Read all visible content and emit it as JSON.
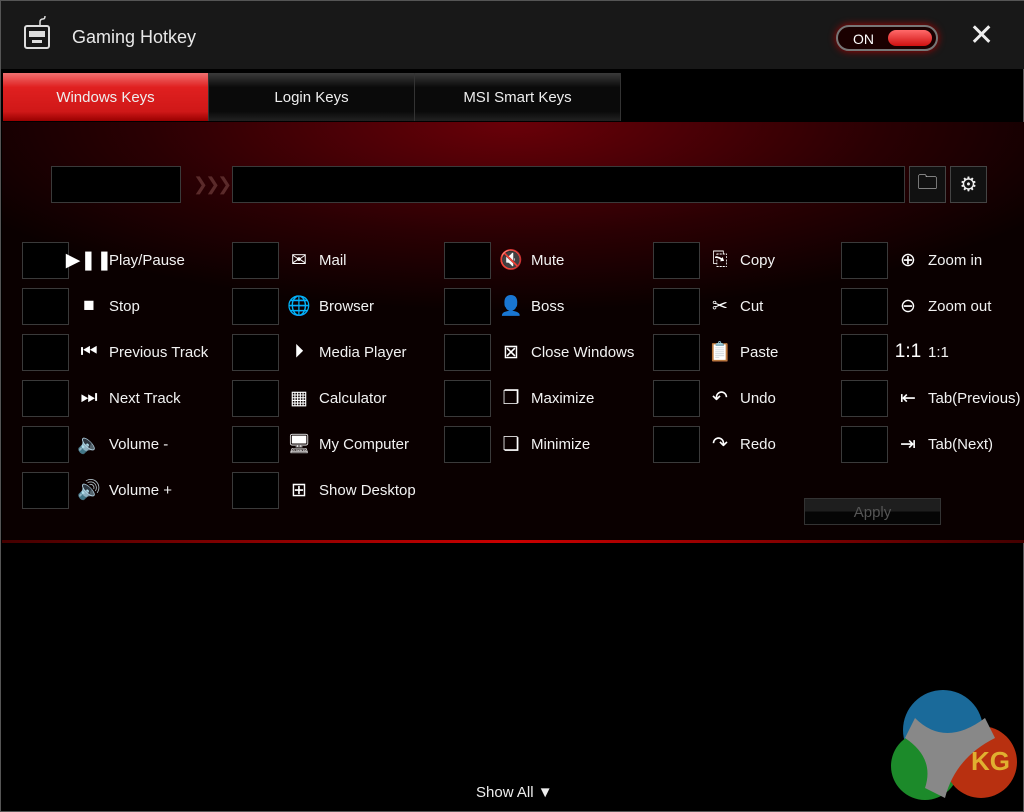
{
  "window": {
    "title": "Gaming Hotkey",
    "toggle_label": "ON",
    "close_icon": "close-icon"
  },
  "tabs": [
    {
      "label": "Windows Keys",
      "active": true
    },
    {
      "label": "Login Keys"
    },
    {
      "label": "MSI Smart Keys"
    }
  ],
  "columns": [
    [
      {
        "label": "Play/Pause",
        "icon": "▶❚❚"
      },
      {
        "label": "Stop",
        "icon": "■"
      },
      {
        "label": "Previous Track",
        "icon": "⏮"
      },
      {
        "label": "Next Track",
        "icon": "⏭"
      },
      {
        "label": "Volume -",
        "icon": "🔈"
      },
      {
        "label": "Volume +",
        "icon": "🔊"
      }
    ],
    [
      {
        "label": "Mail",
        "icon": "✉"
      },
      {
        "label": "Browser",
        "icon": "🌐"
      },
      {
        "label": "Media Player",
        "icon": "⏵"
      },
      {
        "label": "Calculator",
        "icon": "▦"
      },
      {
        "label": "My Computer",
        "icon": "🖥"
      },
      {
        "label": "Show Desktop",
        "icon": "⊞"
      }
    ],
    [
      {
        "label": "Mute",
        "icon": "🔇"
      },
      {
        "label": "Boss",
        "icon": "👤"
      },
      {
        "label": "Close Windows",
        "icon": "⊠"
      },
      {
        "label": "Maximize",
        "icon": "❐"
      },
      {
        "label": "Minimize",
        "icon": "❏"
      }
    ],
    [
      {
        "label": "Copy",
        "icon": "⎘"
      },
      {
        "label": "Cut",
        "icon": "✂"
      },
      {
        "label": "Paste",
        "icon": "📋"
      },
      {
        "label": "Undo",
        "icon": "↶"
      },
      {
        "label": "Redo",
        "icon": "↷"
      }
    ],
    [
      {
        "label": "Zoom in",
        "icon": "⊕"
      },
      {
        "label": "Zoom out",
        "icon": "⊖"
      },
      {
        "label": "1:1",
        "icon": "1:1"
      },
      {
        "label": "Tab(Previous)",
        "icon": "⇤"
      },
      {
        "label": "Tab(Next)",
        "icon": "⇥"
      }
    ]
  ],
  "apply_label": "Apply",
  "show_all_label": "Show All ▼",
  "logo_text": "KG"
}
